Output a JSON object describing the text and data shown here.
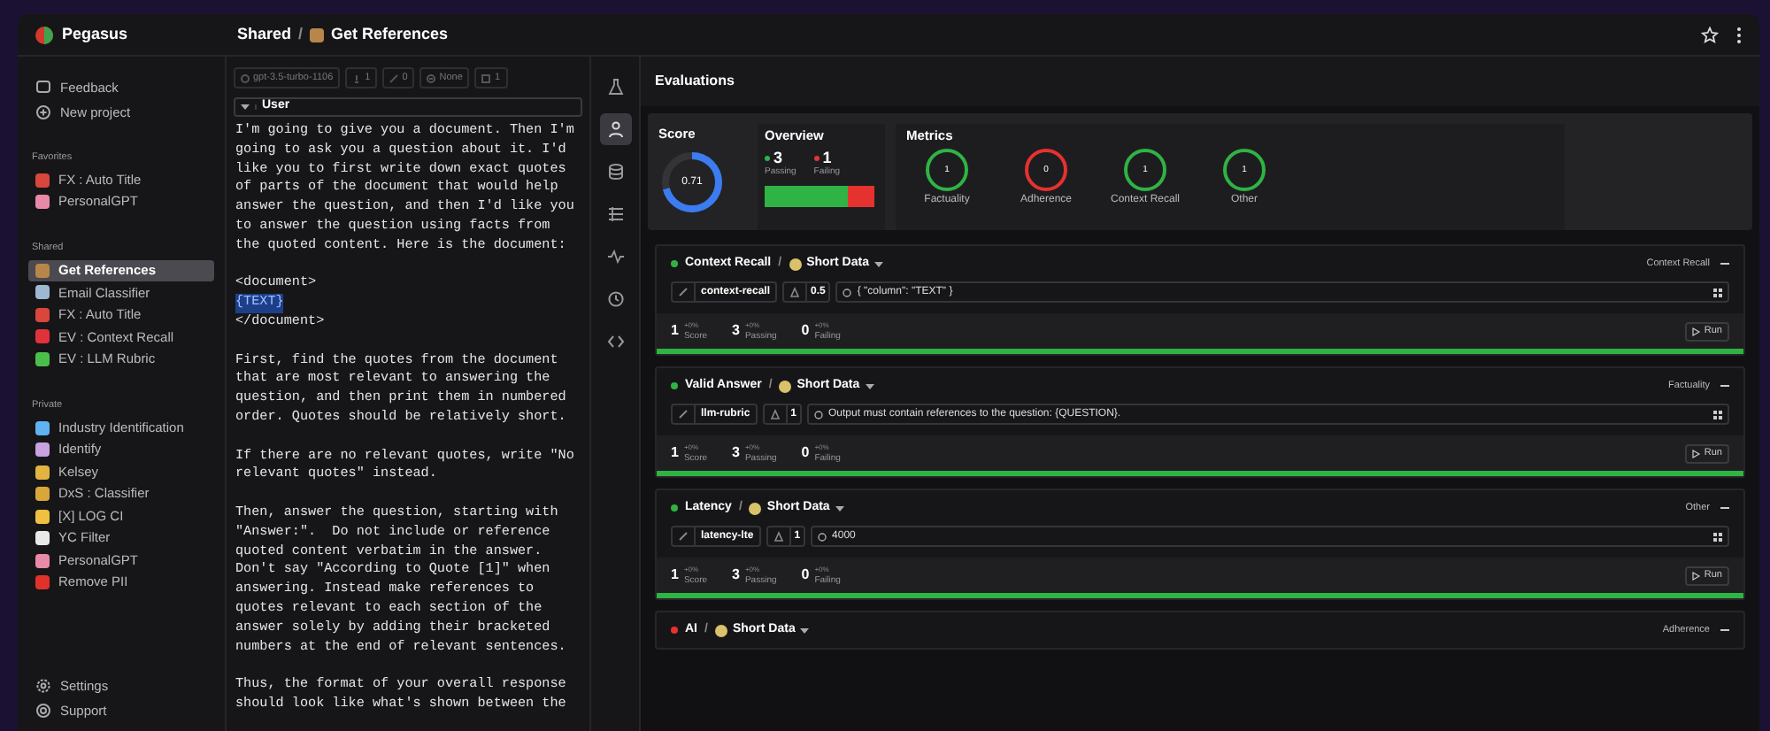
{
  "app": {
    "name": "Pegasus"
  },
  "breadcrumb": {
    "section": "Shared",
    "separator": "/",
    "page": "Get References"
  },
  "sidebar": {
    "top_items": [
      {
        "label": "Feedback",
        "kind": "chat"
      },
      {
        "label": "New project",
        "kind": "plus"
      }
    ],
    "groups": [
      {
        "title": "Favorites",
        "items": [
          {
            "label": "FX : Auto Title",
            "color": "#d9463b",
            "selected": false
          },
          {
            "label": "PersonalGPT",
            "color": "#e889a8",
            "selected": false
          }
        ]
      },
      {
        "title": "Shared",
        "items": [
          {
            "label": "Get References",
            "color": "#b8864a",
            "selected": true
          },
          {
            "label": "Email Classifier",
            "color": "#9fb7d0",
            "selected": false
          },
          {
            "label": "FX : Auto Title",
            "color": "#d9463b",
            "selected": false
          },
          {
            "label": "EV : Context Recall",
            "color": "#e0323a",
            "selected": false
          },
          {
            "label": "EV : LLM Rubric",
            "color": "#4bbf4b",
            "selected": false
          }
        ]
      },
      {
        "title": "Private",
        "items": [
          {
            "label": "Industry Identification",
            "color": "#5fb3f0",
            "selected": false
          },
          {
            "label": "Identify",
            "color": "#c9a0e0",
            "selected": false
          },
          {
            "label": "Kelsey",
            "color": "#e3b341",
            "selected": false
          },
          {
            "label": "DxS : Classifier",
            "color": "#d9a63a",
            "selected": false
          },
          {
            "label": "[X] LOG CI",
            "color": "#f0c040",
            "selected": false
          },
          {
            "label": "YC Filter",
            "color": "#e8e8e8",
            "selected": false
          },
          {
            "label": "PersonalGPT",
            "color": "#e889a8",
            "selected": false
          },
          {
            "label": "Remove PII",
            "color": "#e0322a",
            "selected": false
          }
        ]
      }
    ],
    "bottom_items": [
      {
        "label": "Settings",
        "kind": "gear"
      },
      {
        "label": "Support",
        "kind": "help"
      }
    ]
  },
  "prompt": {
    "toolbar": [
      {
        "kind": "model",
        "text": "gpt-3.5-turbo-1106"
      },
      {
        "kind": "temperature",
        "text": "1"
      },
      {
        "kind": "tokens",
        "text": "0"
      },
      {
        "kind": "format",
        "text": "None"
      },
      {
        "kind": "count",
        "text": "1"
      }
    ],
    "role": "User",
    "paragraphs": [
      {
        "kind": "text",
        "text": "I'm going to give you a document. Then I'm going to ask you a question about it. I'd like you to first write down exact quotes of parts of the document that would help answer the question, and then I'd like you to answer the question using facts from the quoted content. Here is the document:"
      },
      {
        "kind": "code",
        "lines": [
          {
            "kind": "tag",
            "text": "<document>"
          },
          {
            "kind": "variable",
            "text": "{TEXT}"
          },
          {
            "kind": "tag",
            "text": "</document>"
          }
        ]
      },
      {
        "kind": "text",
        "text": "First, find the quotes from the document that are most relevant to answering the question, and then print them in numbered order. Quotes should be relatively short."
      },
      {
        "kind": "text",
        "text": "If there are no relevant quotes, write \"No relevant quotes\" instead."
      },
      {
        "kind": "text",
        "text": "Then, answer the question, starting with \"Answer:\".  Do not include or reference quoted content verbatim in the answer. Don't say \"According to Quote [1]\" when answering. Instead make references to quotes relevant to each section of the answer solely by adding their bracketed numbers at the end of relevant sentences."
      },
      {
        "kind": "text",
        "text": "Thus, the format of your overall response should look like what's shown between the"
      }
    ]
  },
  "rail": [
    {
      "kind": "flask",
      "selected": false
    },
    {
      "kind": "person",
      "selected": true
    },
    {
      "kind": "database",
      "selected": false
    },
    {
      "kind": "list",
      "selected": false
    },
    {
      "kind": "pulse",
      "selected": false
    },
    {
      "kind": "history",
      "selected": false
    },
    {
      "kind": "code",
      "selected": false
    }
  ],
  "evaluations": {
    "title": "Evaluations",
    "score": {
      "title": "Score",
      "value": "0.71",
      "level": 0.71
    },
    "overview": {
      "title": "Overview",
      "passing": "3",
      "passing_label": "Passing",
      "failing": "1",
      "failing_label": "Failing",
      "level": 0.75
    },
    "metrics": {
      "title": "Metrics",
      "items": [
        {
          "value": "1",
          "label": "Factuality",
          "color": "#2fb344"
        },
        {
          "value": "0",
          "label": "Adherence",
          "color": "#e5322f"
        },
        {
          "value": "1",
          "label": "Context Recall",
          "color": "#2fb344"
        },
        {
          "value": "1",
          "label": "Other",
          "color": "#2fb344"
        }
      ]
    },
    "cards": [
      {
        "name": "Context Recall",
        "separator": "/",
        "dataset": "Short Data",
        "metric": "Context Recall",
        "color": "#2fb344",
        "key": "context-recall",
        "threshold": "0.5",
        "config": "{ \"column\": \"TEXT\" }",
        "stats": [
          {
            "value": "1",
            "delta": "+0%",
            "label": "Score"
          },
          {
            "value": "3",
            "delta": "+0%",
            "label": "Passing"
          },
          {
            "value": "0",
            "delta": "+0%",
            "label": "Failing"
          }
        ],
        "run": "Run",
        "level": 1
      },
      {
        "name": "Valid Answer",
        "separator": "/",
        "dataset": "Short Data",
        "metric": "Factuality",
        "color": "#2fb344",
        "key": "llm-rubric",
        "threshold": "1",
        "config": "Output must contain references to the question: {QUESTION}.",
        "stats": [
          {
            "value": "1",
            "delta": "+0%",
            "label": "Score"
          },
          {
            "value": "3",
            "delta": "+0%",
            "label": "Passing"
          },
          {
            "value": "0",
            "delta": "+0%",
            "label": "Failing"
          }
        ],
        "run": "Run",
        "level": 1
      },
      {
        "name": "Latency",
        "separator": "/",
        "dataset": "Short Data",
        "metric": "Other",
        "color": "#2fb344",
        "key": "latency-lte",
        "threshold": "1",
        "config": "4000",
        "stats": [
          {
            "value": "1",
            "delta": "+0%",
            "label": "Score"
          },
          {
            "value": "3",
            "delta": "+0%",
            "label": "Passing"
          },
          {
            "value": "0",
            "delta": "+0%",
            "label": "Failing"
          }
        ],
        "run": "Run",
        "level": 1
      },
      {
        "name": "AI",
        "separator": "/",
        "dataset": "Short Data",
        "metric": "Adherence",
        "color": "#e5322f"
      }
    ]
  }
}
